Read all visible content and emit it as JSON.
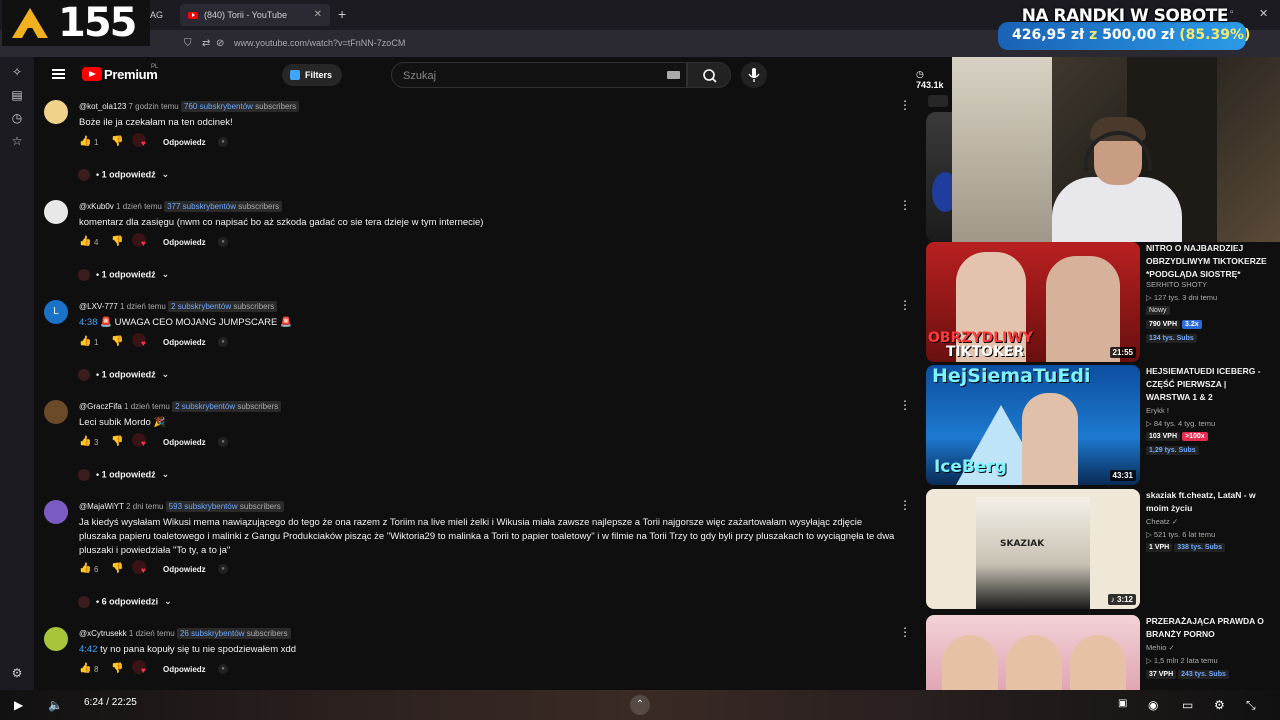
{
  "browser": {
    "tab_title": "(840) Torii - YouTube",
    "tab_partial": "AG",
    "url": "www.youtube.com/watch?v=tFnNN-7zoCM"
  },
  "overlay": {
    "counter": "155",
    "goal_title": "NA RANDKI W SOBOTE",
    "goal_current": "426,95 zł",
    "goal_sep": "z",
    "goal_target": "500,00 zł",
    "goal_percent": "(85.39%)"
  },
  "header": {
    "logo_text": "Premium",
    "logo_region": "PL",
    "filters_label": "Filters",
    "search_placeholder": "Szukaj",
    "timer": "743.1k"
  },
  "comments": [
    {
      "user": "@kot_ola123",
      "time": "7 godzin temu",
      "subs": "760 subskrybentów",
      "subs_suffix": "subscribers",
      "ts": "",
      "text": "Boże ile ja czekałam na ten odcinek!",
      "likes": "1",
      "reply_label": "Odpowiedz",
      "replies": "1 odpowiedź",
      "avatar": "#f0d28b"
    },
    {
      "user": "@xKub0v",
      "time": "1 dzień temu",
      "subs": "377 subskrybentów",
      "subs_suffix": "subscribers",
      "ts": "",
      "text": "komentarz dla zasięgu (nwm co napisać bo aż szkoda gadać co sie tera dzieje w tym internecie)",
      "likes": "4",
      "reply_label": "Odpowiedz",
      "replies": "1 odpowiedź",
      "avatar": "#e8e8e8"
    },
    {
      "user": "@LXV-777",
      "time": "1 dzień temu",
      "subs": "2 subskrybentów",
      "subs_suffix": "subscribers",
      "ts": "4:38",
      "text": "🚨 UWAGA CEO MOJANG JUMPSCARE 🚨",
      "likes": "1",
      "reply_label": "Odpowiedz",
      "replies": "1 odpowiedź",
      "avatar": "#1a73c9",
      "avatar_letter": "L"
    },
    {
      "user": "@GraczFifa",
      "time": "1 dzień temu",
      "subs": "2 subskrybentów",
      "subs_suffix": "subscribers",
      "ts": "",
      "text": "Leci subik Mordo 🎉",
      "likes": "3",
      "reply_label": "Odpowiedz",
      "replies": "1 odpowiedź",
      "avatar": "#6b4a2a"
    },
    {
      "user": "@MajaWiYT",
      "time": "2 dni temu",
      "subs": "593 subskrybentów",
      "subs_suffix": "subscribers",
      "ts": "",
      "text": "Ja kiedyś wysłałam Wikusi mema nawiązującego do tego że ona razem z Toriim na live mieli żelki i Wikusia miała zawsze najlepsze a Torii najgorsze więc zażartowałam wysyłając zdjęcie pluszaka papieru toaletowego i malinki z Gangu Produkciaków pisząc że \"Wiktoria29 to malinka a Torii to papier toaletowy\" i w filmie na Torii Trzy to gdy byli przy pluszakach to wyciągnęła te dwa pluszaki i powiedziała \"To ty, a to ja\"",
      "likes": "6",
      "reply_label": "Odpowiedz",
      "replies": "6 odpowiedzi",
      "avatar": "#7b5cc4"
    },
    {
      "user": "@xCytrusekk",
      "time": "1 dzień temu",
      "subs": "26 subskrybentów",
      "subs_suffix": "subscribers",
      "ts": "4:42",
      "text": "ty no pana kopuły się tu nie spodziewałem xdd",
      "likes": "8",
      "reply_label": "Odpowiedz",
      "replies": "",
      "avatar": "#a8c43a"
    }
  ],
  "videos": [
    {
      "title": "NITRO O NAJBARDZIEJ OBRZYDLIWYM TIKTOKERZE *PODGLĄDA SIOSTRĘ*",
      "channel": "SERHITO SHOTY",
      "stats": "▷ 127 tys.  3 dni temu",
      "new": "Nowy",
      "vph": "790 VPH",
      "ratio": "3.2x",
      "subs": "134 tys. Subs",
      "duration": "21:55",
      "thumb_cap1": "OBRZYDLIWY",
      "thumb_cap2": "TIKTOKER"
    },
    {
      "title": "HEJSIEMATUEDI ICEBERG - CZĘŚĆ PIERWSZA | WARSTWA 1 & 2",
      "channel": "Erykk !",
      "stats": "▷ 84 tys.  4 tyg. temu",
      "vph": "103 VPH",
      "ratio": ">100x",
      "subs": "1,29 tys. Subs",
      "duration": "43:31",
      "thumb_cap1": "HejSiemaTuEdi",
      "thumb_cap2": "IceBerg"
    },
    {
      "title": "skaziak ft.cheatz, LataN - w moim życiu",
      "channel": "Cheatz ✓",
      "stats": "▷ 521 tys.  6 lat temu",
      "vph": "1 VPH",
      "subs": "338 tys. Subs",
      "duration": "♪ 3:12",
      "thumb_cap1": "SKAZIAK"
    },
    {
      "title": "PRZERAŻAJĄCA PRAWDA O BRANŻY PORNO",
      "channel": "Mehio ✓",
      "stats": "▷ 1,5 mln  2 lata temu",
      "vph": "37 VPH",
      "subs": "243 tys. Subs"
    }
  ],
  "player": {
    "time": "6:24 / 22:25"
  }
}
